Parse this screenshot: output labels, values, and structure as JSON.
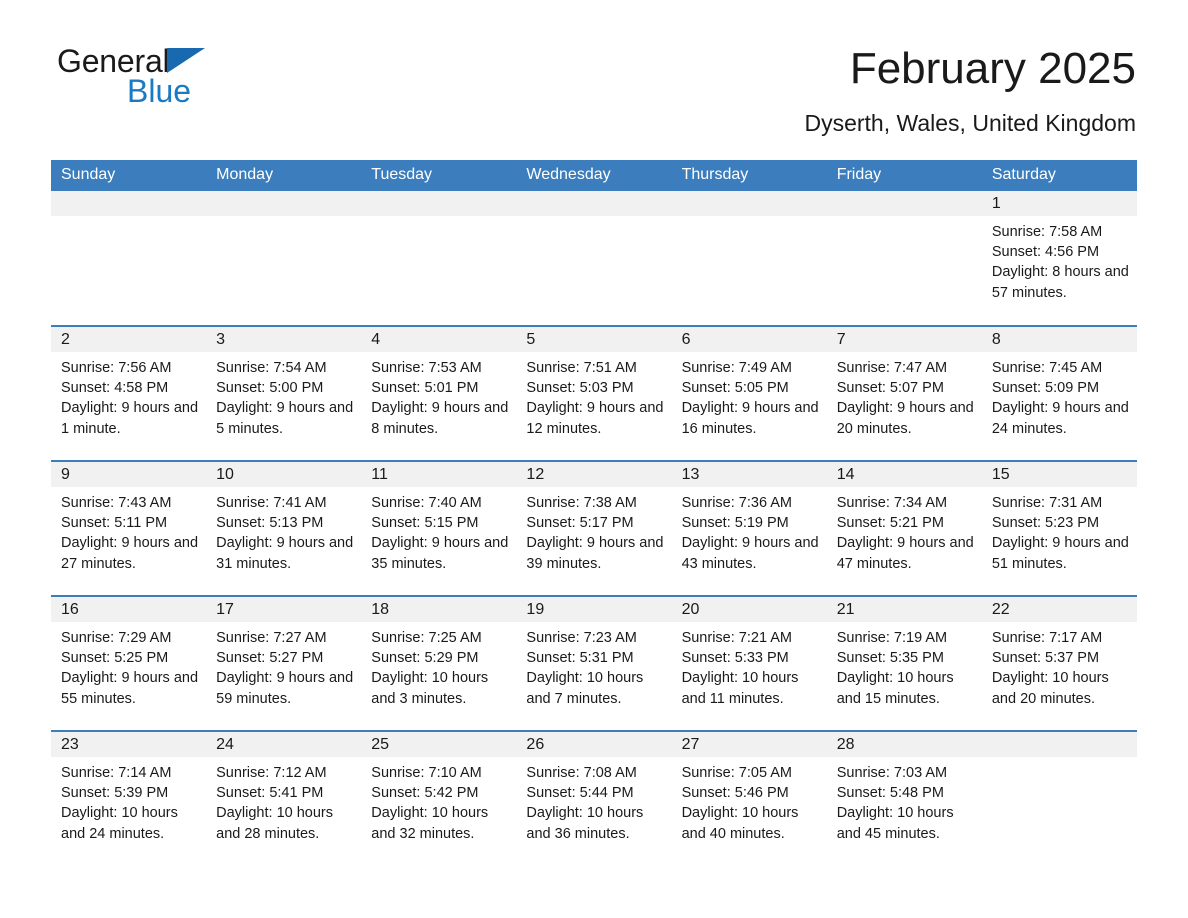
{
  "brand": {
    "name_part1": "General",
    "name_part2": "Blue",
    "triangle_color": "#1869b0",
    "blue_color": "#1a7bc4"
  },
  "header": {
    "title": "February 2025",
    "subtitle": "Dyserth, Wales, United Kingdom"
  },
  "theme": {
    "header_blue": "#3b7dbd",
    "daynum_band": "#f1f1f1",
    "text": "#1a1a1a"
  },
  "calendar": {
    "weekday_headers": [
      "Sunday",
      "Monday",
      "Tuesday",
      "Wednesday",
      "Thursday",
      "Friday",
      "Saturday"
    ],
    "labels": {
      "sunrise": "Sunrise:",
      "sunset": "Sunset:",
      "daylight": "Daylight:"
    },
    "weeks": [
      [
        {
          "day": "",
          "empty": true
        },
        {
          "day": "",
          "empty": true
        },
        {
          "day": "",
          "empty": true
        },
        {
          "day": "",
          "empty": true
        },
        {
          "day": "",
          "empty": true
        },
        {
          "day": "",
          "empty": true
        },
        {
          "day": "1",
          "sunrise": "Sunrise: 7:58 AM",
          "sunset": "Sunset: 4:56 PM",
          "daylight": "Daylight: 8 hours and 57 minutes."
        }
      ],
      [
        {
          "day": "2",
          "sunrise": "Sunrise: 7:56 AM",
          "sunset": "Sunset: 4:58 PM",
          "daylight": "Daylight: 9 hours and 1 minute."
        },
        {
          "day": "3",
          "sunrise": "Sunrise: 7:54 AM",
          "sunset": "Sunset: 5:00 PM",
          "daylight": "Daylight: 9 hours and 5 minutes."
        },
        {
          "day": "4",
          "sunrise": "Sunrise: 7:53 AM",
          "sunset": "Sunset: 5:01 PM",
          "daylight": "Daylight: 9 hours and 8 minutes."
        },
        {
          "day": "5",
          "sunrise": "Sunrise: 7:51 AM",
          "sunset": "Sunset: 5:03 PM",
          "daylight": "Daylight: 9 hours and 12 minutes."
        },
        {
          "day": "6",
          "sunrise": "Sunrise: 7:49 AM",
          "sunset": "Sunset: 5:05 PM",
          "daylight": "Daylight: 9 hours and 16 minutes."
        },
        {
          "day": "7",
          "sunrise": "Sunrise: 7:47 AM",
          "sunset": "Sunset: 5:07 PM",
          "daylight": "Daylight: 9 hours and 20 minutes."
        },
        {
          "day": "8",
          "sunrise": "Sunrise: 7:45 AM",
          "sunset": "Sunset: 5:09 PM",
          "daylight": "Daylight: 9 hours and 24 minutes."
        }
      ],
      [
        {
          "day": "9",
          "sunrise": "Sunrise: 7:43 AM",
          "sunset": "Sunset: 5:11 PM",
          "daylight": "Daylight: 9 hours and 27 minutes."
        },
        {
          "day": "10",
          "sunrise": "Sunrise: 7:41 AM",
          "sunset": "Sunset: 5:13 PM",
          "daylight": "Daylight: 9 hours and 31 minutes."
        },
        {
          "day": "11",
          "sunrise": "Sunrise: 7:40 AM",
          "sunset": "Sunset: 5:15 PM",
          "daylight": "Daylight: 9 hours and 35 minutes."
        },
        {
          "day": "12",
          "sunrise": "Sunrise: 7:38 AM",
          "sunset": "Sunset: 5:17 PM",
          "daylight": "Daylight: 9 hours and 39 minutes."
        },
        {
          "day": "13",
          "sunrise": "Sunrise: 7:36 AM",
          "sunset": "Sunset: 5:19 PM",
          "daylight": "Daylight: 9 hours and 43 minutes."
        },
        {
          "day": "14",
          "sunrise": "Sunrise: 7:34 AM",
          "sunset": "Sunset: 5:21 PM",
          "daylight": "Daylight: 9 hours and 47 minutes."
        },
        {
          "day": "15",
          "sunrise": "Sunrise: 7:31 AM",
          "sunset": "Sunset: 5:23 PM",
          "daylight": "Daylight: 9 hours and 51 minutes."
        }
      ],
      [
        {
          "day": "16",
          "sunrise": "Sunrise: 7:29 AM",
          "sunset": "Sunset: 5:25 PM",
          "daylight": "Daylight: 9 hours and 55 minutes."
        },
        {
          "day": "17",
          "sunrise": "Sunrise: 7:27 AM",
          "sunset": "Sunset: 5:27 PM",
          "daylight": "Daylight: 9 hours and 59 minutes."
        },
        {
          "day": "18",
          "sunrise": "Sunrise: 7:25 AM",
          "sunset": "Sunset: 5:29 PM",
          "daylight": "Daylight: 10 hours and 3 minutes."
        },
        {
          "day": "19",
          "sunrise": "Sunrise: 7:23 AM",
          "sunset": "Sunset: 5:31 PM",
          "daylight": "Daylight: 10 hours and 7 minutes."
        },
        {
          "day": "20",
          "sunrise": "Sunrise: 7:21 AM",
          "sunset": "Sunset: 5:33 PM",
          "daylight": "Daylight: 10 hours and 11 minutes."
        },
        {
          "day": "21",
          "sunrise": "Sunrise: 7:19 AM",
          "sunset": "Sunset: 5:35 PM",
          "daylight": "Daylight: 10 hours and 15 minutes."
        },
        {
          "day": "22",
          "sunrise": "Sunrise: 7:17 AM",
          "sunset": "Sunset: 5:37 PM",
          "daylight": "Daylight: 10 hours and 20 minutes."
        }
      ],
      [
        {
          "day": "23",
          "sunrise": "Sunrise: 7:14 AM",
          "sunset": "Sunset: 5:39 PM",
          "daylight": "Daylight: 10 hours and 24 minutes."
        },
        {
          "day": "24",
          "sunrise": "Sunrise: 7:12 AM",
          "sunset": "Sunset: 5:41 PM",
          "daylight": "Daylight: 10 hours and 28 minutes."
        },
        {
          "day": "25",
          "sunrise": "Sunrise: 7:10 AM",
          "sunset": "Sunset: 5:42 PM",
          "daylight": "Daylight: 10 hours and 32 minutes."
        },
        {
          "day": "26",
          "sunrise": "Sunrise: 7:08 AM",
          "sunset": "Sunset: 5:44 PM",
          "daylight": "Daylight: 10 hours and 36 minutes."
        },
        {
          "day": "27",
          "sunrise": "Sunrise: 7:05 AM",
          "sunset": "Sunset: 5:46 PM",
          "daylight": "Daylight: 10 hours and 40 minutes."
        },
        {
          "day": "28",
          "sunrise": "Sunrise: 7:03 AM",
          "sunset": "Sunset: 5:48 PM",
          "daylight": "Daylight: 10 hours and 45 minutes."
        },
        {
          "day": "",
          "empty": true
        }
      ]
    ]
  }
}
